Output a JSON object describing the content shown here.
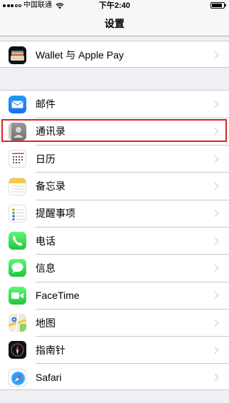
{
  "status_bar": {
    "carrier": "中国联通",
    "time": "下午2:40"
  },
  "nav": {
    "title": "设置"
  },
  "group1": [
    {
      "label": "Wallet 与 Apple Pay",
      "icon": "wallet-icon"
    }
  ],
  "group2": [
    {
      "label": "邮件",
      "icon": "mail-icon"
    },
    {
      "label": "通讯录",
      "icon": "contacts-icon"
    },
    {
      "label": "日历",
      "icon": "calendar-icon"
    },
    {
      "label": "备忘录",
      "icon": "notes-icon"
    },
    {
      "label": "提醒事项",
      "icon": "reminders-icon"
    },
    {
      "label": "电话",
      "icon": "phone-icon"
    },
    {
      "label": "信息",
      "icon": "messages-icon"
    },
    {
      "label": "FaceTime",
      "icon": "facetime-icon"
    },
    {
      "label": "地图",
      "icon": "maps-icon"
    },
    {
      "label": "指南针",
      "icon": "compass-icon"
    },
    {
      "label": "Safari",
      "icon": "safari-icon"
    }
  ],
  "colors": {
    "highlight": "#d9232a",
    "background": "#efeff4"
  }
}
